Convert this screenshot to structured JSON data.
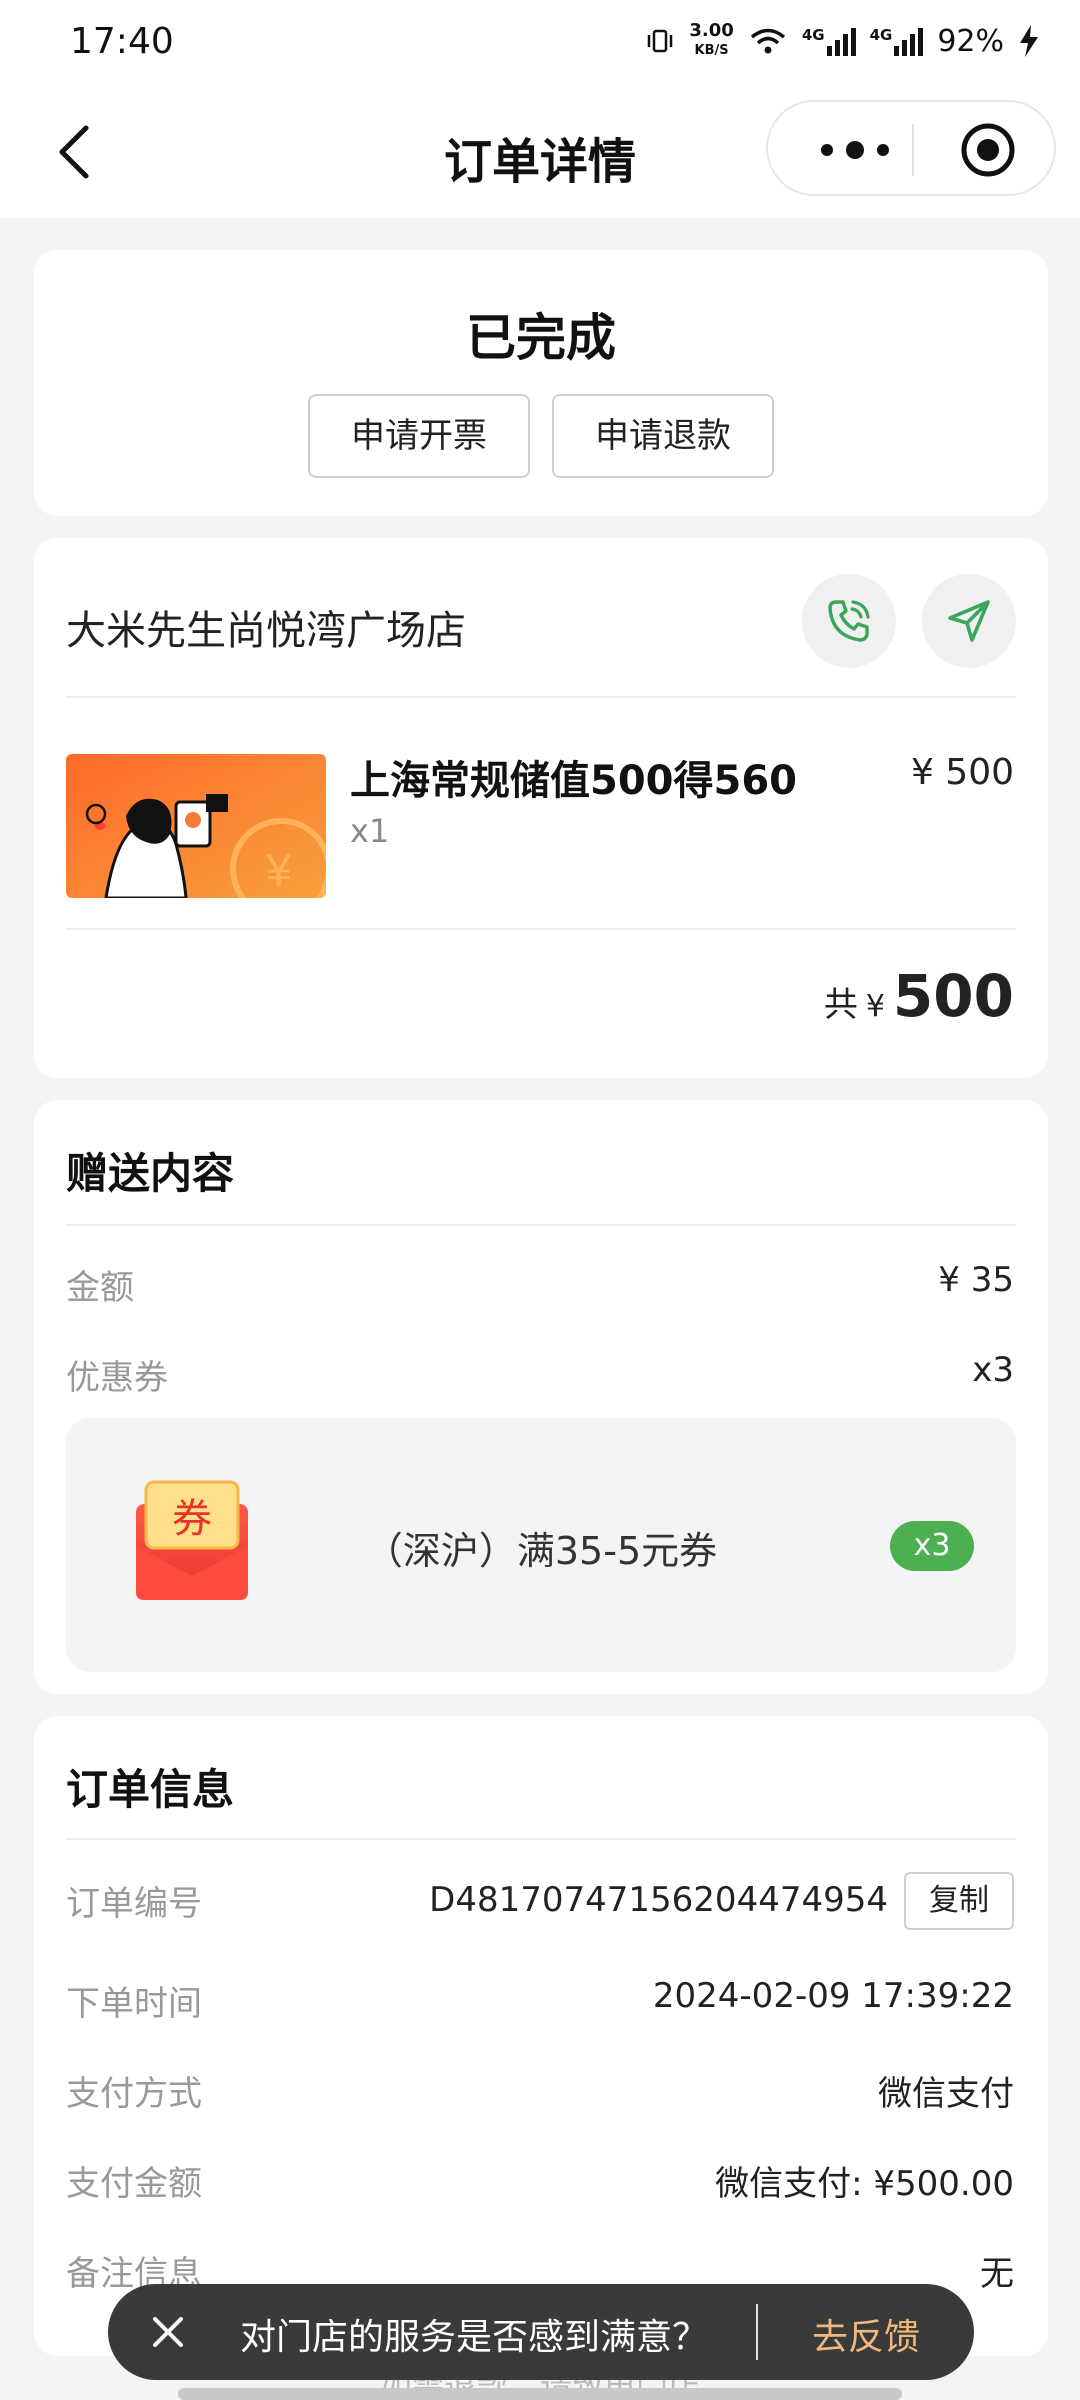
{
  "status_bar": {
    "time": "17:40",
    "net_speed_value": "3.00",
    "net_speed_unit": "KB/S",
    "net_type_1": "4G",
    "net_type_2": "4G",
    "battery": "92%",
    "icons": [
      "vibrate-icon",
      "wifi-icon",
      "signal-icon",
      "signal-icon",
      "charging-icon"
    ]
  },
  "nav": {
    "title": "订单详情",
    "back_icon": "chevron-left-icon",
    "more_icon": "more-dots-icon",
    "close_icon": "target-circle-icon"
  },
  "order_status": {
    "title": "已完成",
    "invoice_button": "申请开票",
    "refund_button": "申请退款"
  },
  "store": {
    "name": "大米先生尚悦湾广场店",
    "phone_icon": "phone-icon",
    "navigate_icon": "navigate-icon",
    "product": {
      "name": "上海常规储值500得560",
      "quantity": "x1",
      "price": "¥ 500"
    },
    "total_label": "共",
    "total_currency": "¥",
    "total_amount": "500"
  },
  "gift": {
    "title": "赠送内容",
    "amount_label": "金额",
    "amount_value": "¥ 35",
    "coupon_label": "优惠券",
    "coupon_count": "x3",
    "coupon": {
      "icon_text": "券",
      "name": "（深沪）满35-5元券",
      "badge": "x3"
    }
  },
  "order_info": {
    "title": "订单信息",
    "rows": [
      {
        "label": "订单编号",
        "value": "D48170747156204474954"
      },
      {
        "label": "下单时间",
        "value": "2024-02-09 17:39:22"
      },
      {
        "label": "支付方式",
        "value": "微信支付"
      },
      {
        "label": "支付金额",
        "value": "微信支付: ¥500.00"
      },
      {
        "label": "备注信息",
        "value": "无"
      }
    ],
    "copy_button": "复制"
  },
  "toast": {
    "text": "对门店的服务是否感到满意？",
    "action": "去反馈"
  },
  "refund_hint": "如需退款，请致电门店",
  "colors": {
    "accent_green": "#4caf50",
    "feedback_orange": "#f0b87a",
    "product_orange": "#f47a3a"
  }
}
